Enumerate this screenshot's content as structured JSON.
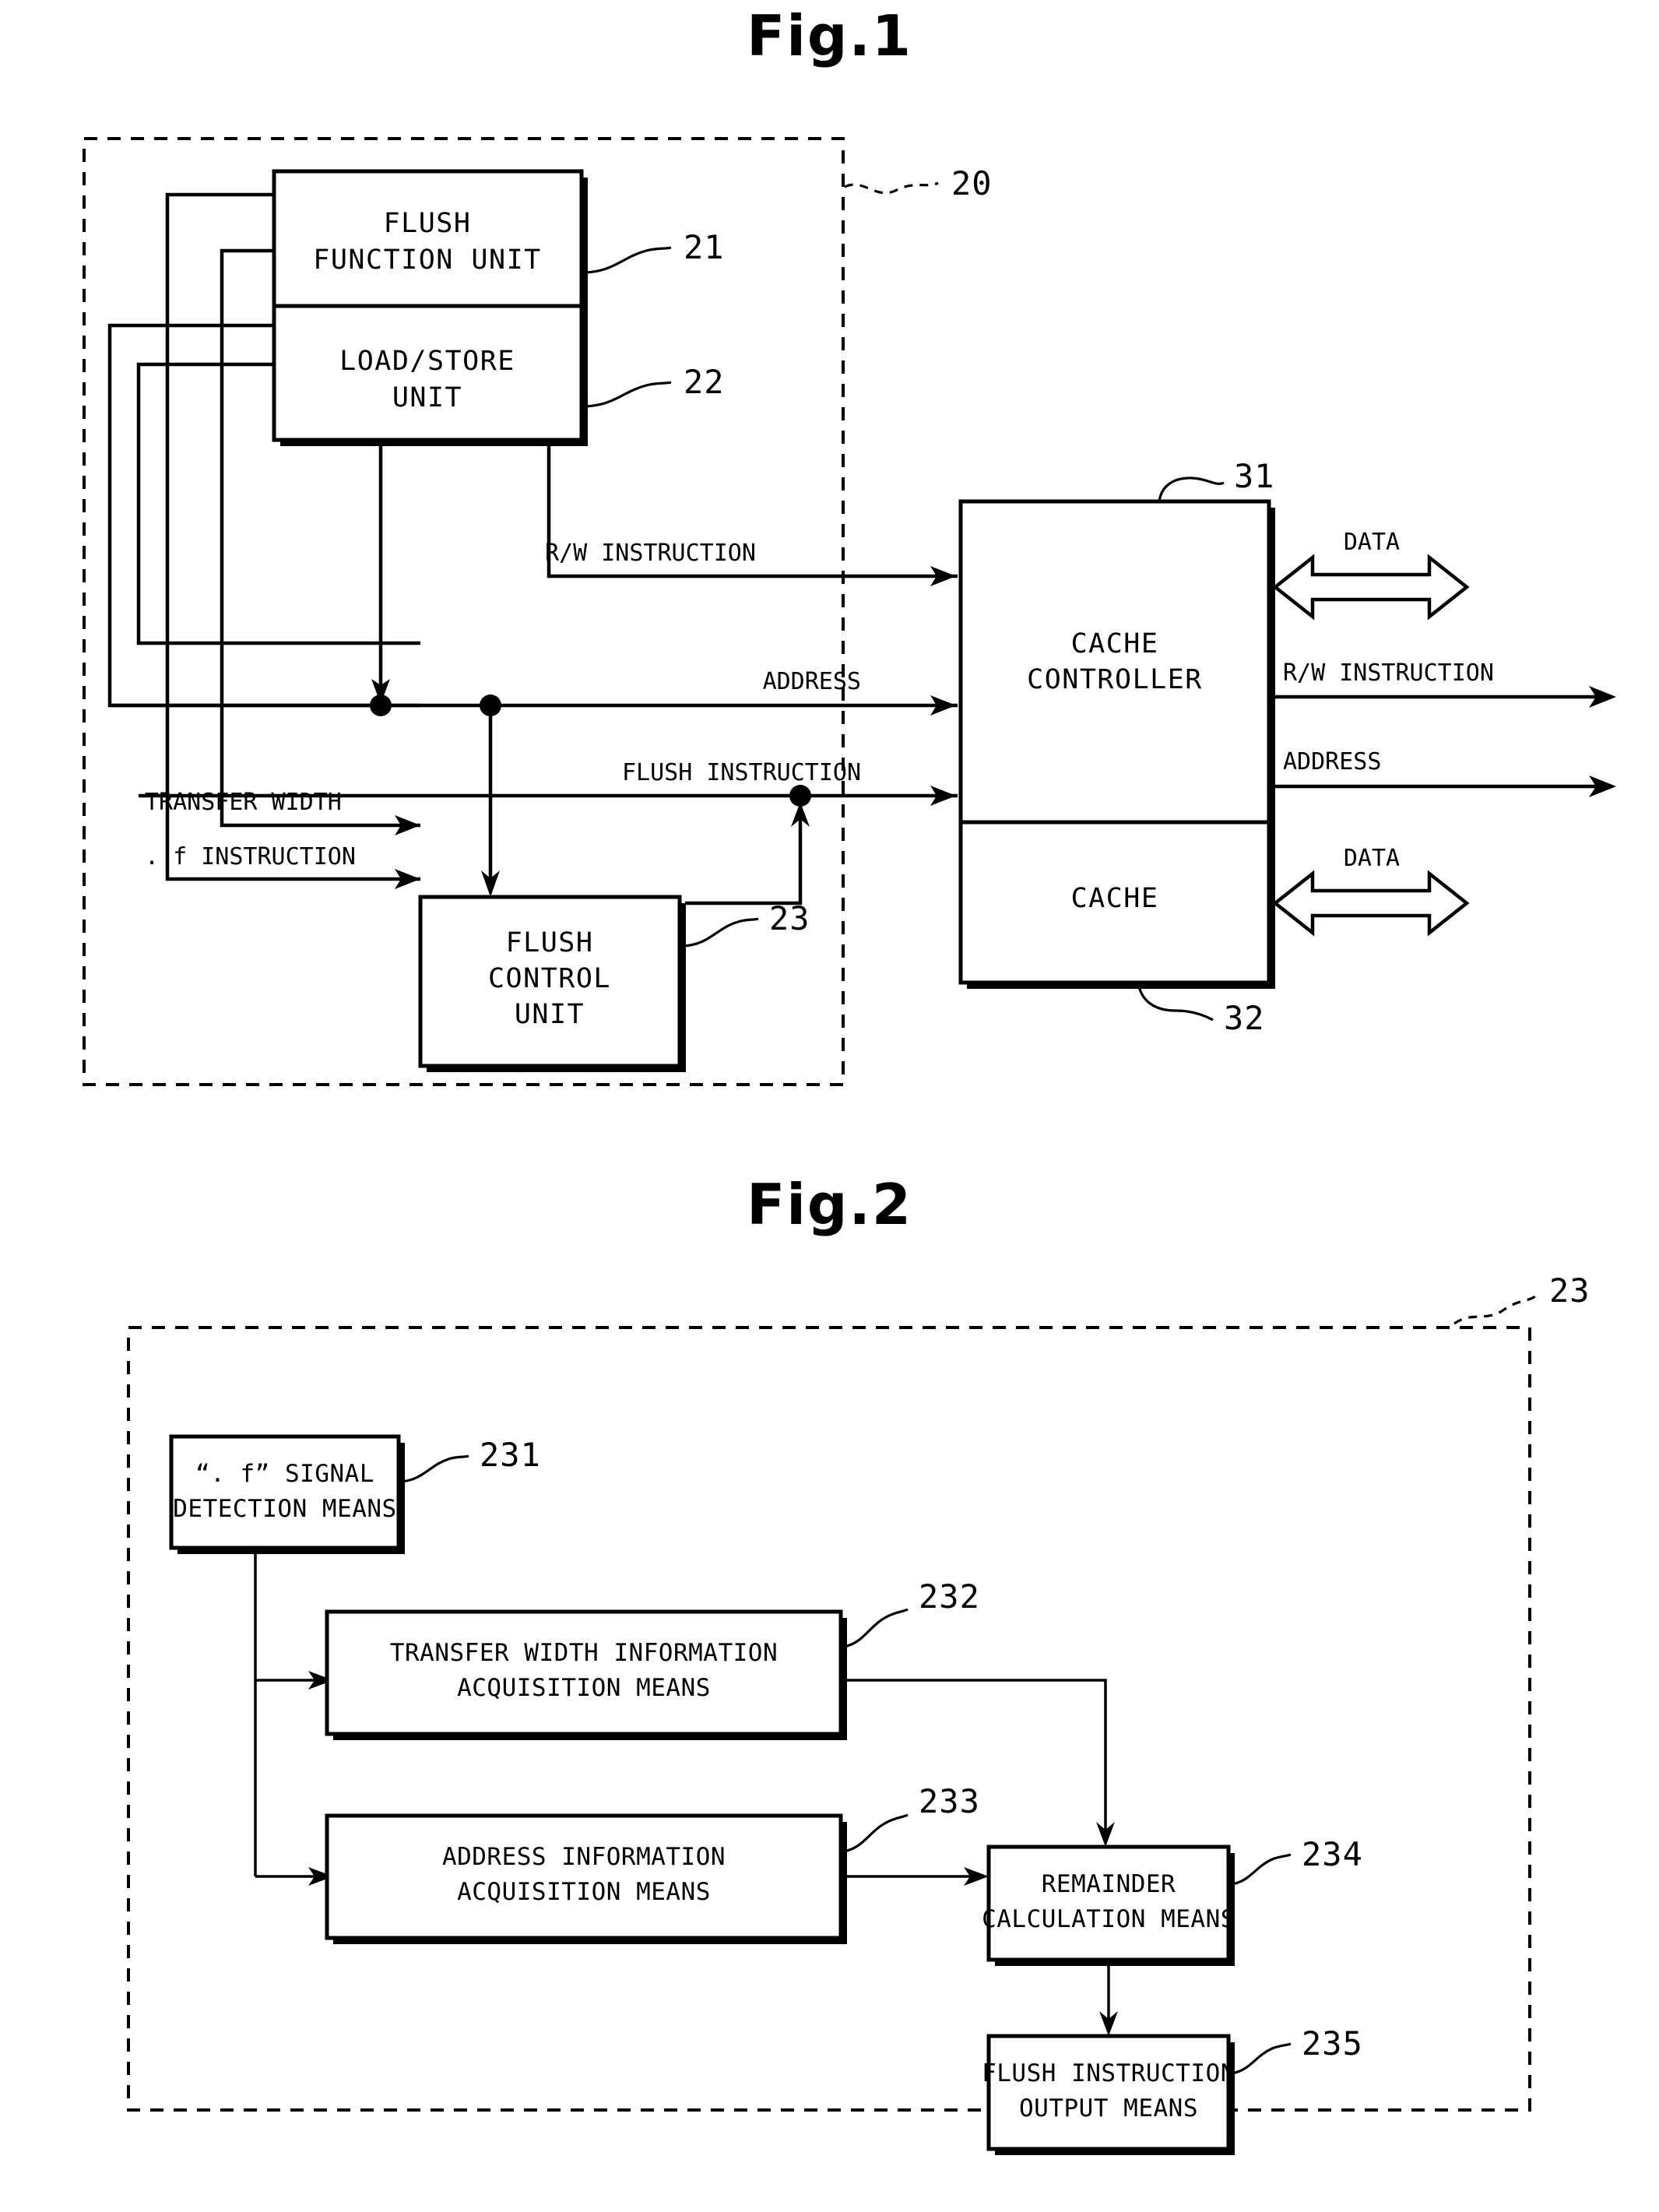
{
  "figures": [
    {
      "title": "Fig.1",
      "outer_ref": "20",
      "blocks": [
        {
          "id": "flush-function-unit",
          "lines": [
            "FLUSH",
            "FUNCTION UNIT"
          ],
          "ref": "21"
        },
        {
          "id": "load-store-unit",
          "lines": [
            "LOAD/STORE",
            "UNIT"
          ],
          "ref": "22"
        },
        {
          "id": "flush-control-unit",
          "lines": [
            "FLUSH",
            "CONTROL",
            "UNIT"
          ],
          "ref": "23"
        },
        {
          "id": "cache-controller",
          "lines": [
            "CACHE",
            "CONTROLLER"
          ],
          "ref": "31"
        },
        {
          "id": "cache",
          "lines": [
            "CACHE"
          ],
          "ref": "32"
        }
      ],
      "signal_labels": [
        {
          "id": "rw-instruction-in",
          "text": "R/W INSTRUCTION"
        },
        {
          "id": "address-in",
          "text": "ADDRESS"
        },
        {
          "id": "flush-instruction-in",
          "text": "FLUSH INSTRUCTION"
        },
        {
          "id": "transfer-width",
          "text": "TRANSFER WIDTH"
        },
        {
          "id": "f-instruction",
          "text": ". f INSTRUCTION"
        },
        {
          "id": "data-top",
          "text": "DATA"
        },
        {
          "id": "rw-instruction-out",
          "text": "R/W INSTRUCTION"
        },
        {
          "id": "address-out",
          "text": "ADDRESS"
        },
        {
          "id": "data-bottom",
          "text": "DATA"
        }
      ]
    },
    {
      "title": "Fig.2",
      "outer_ref": "23",
      "blocks": [
        {
          "id": "f-signal-detection-means",
          "lines": [
            "“. f” SIGNAL",
            "DETECTION MEANS"
          ],
          "ref": "231"
        },
        {
          "id": "transfer-width-information-acquisition-means",
          "lines": [
            "TRANSFER WIDTH INFORMATION",
            "ACQUISITION MEANS"
          ],
          "ref": "232"
        },
        {
          "id": "address-information-acquisition-means",
          "lines": [
            "ADDRESS INFORMATION",
            "ACQUISITION MEANS"
          ],
          "ref": "233"
        },
        {
          "id": "remainder-calculation-means",
          "lines": [
            "REMAINDER",
            "CALCULATION MEANS"
          ],
          "ref": "234"
        },
        {
          "id": "flush-instruction-output-means",
          "lines": [
            "FLUSH INSTRUCTION",
            "OUTPUT MEANS"
          ],
          "ref": "235"
        }
      ]
    }
  ],
  "fig1": {
    "title": "Fig.1",
    "ref_20": "20",
    "ref_21": "21",
    "ref_22": "22",
    "ref_23": "23",
    "ref_31": "31",
    "ref_32": "32",
    "flush_function_unit_l1": "FLUSH",
    "flush_function_unit_l2": "FUNCTION UNIT",
    "load_store_unit_l1": "LOAD/STORE",
    "load_store_unit_l2": "UNIT",
    "flush_control_unit_l1": "FLUSH",
    "flush_control_unit_l2": "CONTROL",
    "flush_control_unit_l3": "UNIT",
    "cache_controller_l1": "CACHE",
    "cache_controller_l2": "CONTROLLER",
    "cache_l1": "CACHE",
    "rw_instruction_in": "R/W INSTRUCTION",
    "address_in": "ADDRESS",
    "flush_instruction_in": "FLUSH INSTRUCTION",
    "transfer_width": "TRANSFER WIDTH",
    "f_instruction": ". f INSTRUCTION",
    "data_top": "DATA",
    "rw_instruction_out": "R/W INSTRUCTION",
    "address_out": "ADDRESS",
    "data_bottom": "DATA"
  },
  "fig2": {
    "title": "Fig.2",
    "ref_23": "23",
    "ref_231": "231",
    "ref_232": "232",
    "ref_233": "233",
    "ref_234": "234",
    "ref_235": "235",
    "b231_l1": "“. f” SIGNAL",
    "b231_l2": "DETECTION MEANS",
    "b232_l1": "TRANSFER WIDTH INFORMATION",
    "b232_l2": "ACQUISITION MEANS",
    "b233_l1": "ADDRESS INFORMATION",
    "b233_l2": "ACQUISITION MEANS",
    "b234_l1": "REMAINDER",
    "b234_l2": "CALCULATION MEANS",
    "b235_l1": "FLUSH INSTRUCTION",
    "b235_l2": "OUTPUT MEANS"
  },
  "colors": {
    "ink": "#000000",
    "paper": "#ffffff"
  }
}
